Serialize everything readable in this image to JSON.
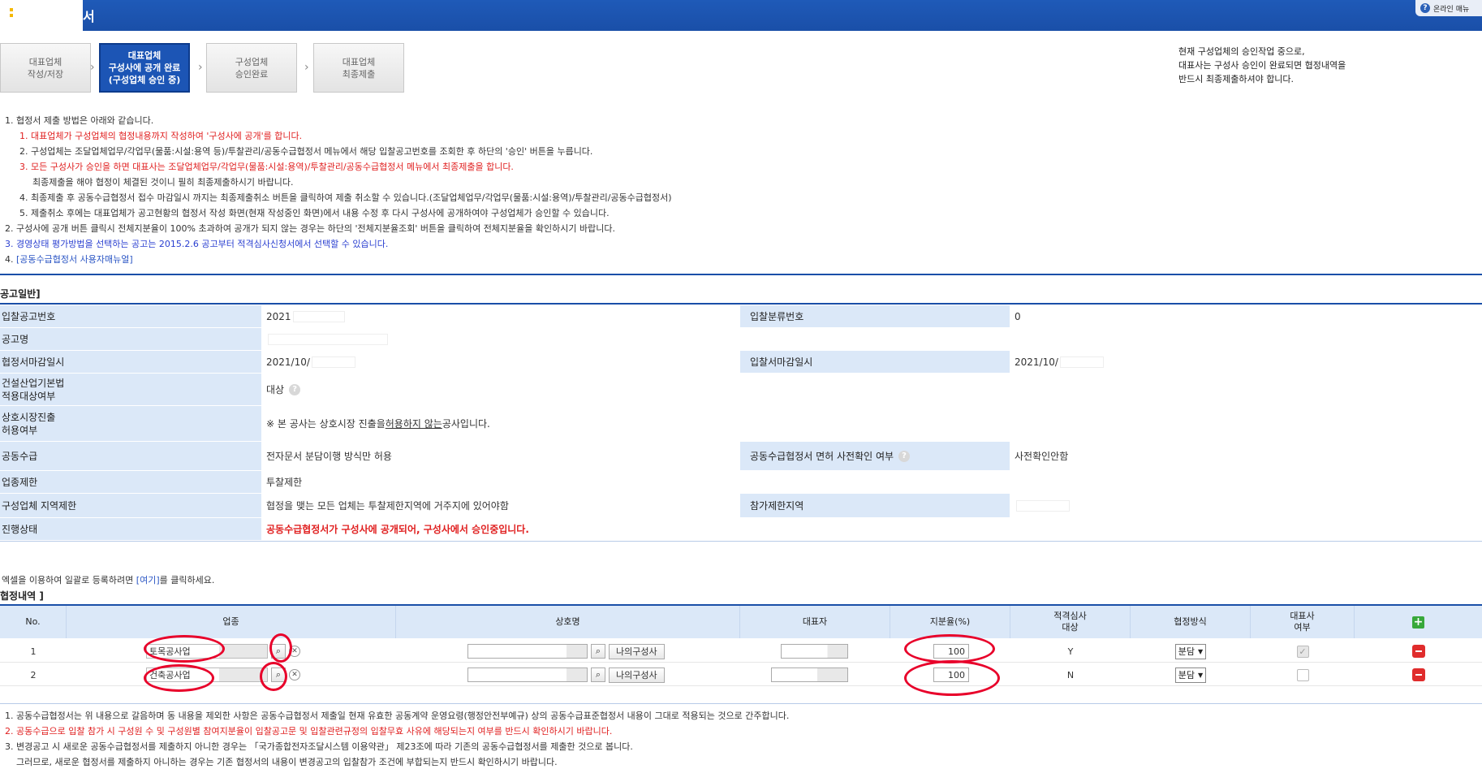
{
  "header": {
    "title": "서",
    "online_menu": "온라인 매뉴",
    "help_glyph": "?"
  },
  "steps": [
    {
      "label": "대표업체\n작성/저장"
    },
    {
      "label": "대표업체\n구성사에 공개 완료\n(구성업체 승인 중)"
    },
    {
      "label": "구성업체\n승인완료"
    },
    {
      "label": "대표업체\n최종제출"
    }
  ],
  "notice_right": "현재 구성업체의 승인작업 중으로,\n대표사는 구성사 승인이 완료되면 협정내역을\n반드시 최종제출하셔야 합니다.",
  "instructions": {
    "i1": "1. 협정서 제출 방법은 아래와 같습니다.",
    "i1_1": "1. 대표업체가 구성업체의 협정내용까지 작성하여 '구성사에 공개'를 합니다.",
    "i1_2": "2. 구성업체는 조달업체업무/각업무(물품:시설:용역 등)/투찰관리/공동수급협정서 메뉴에서 해당 입찰공고번호를 조회한 후 하단의 '승인' 버튼을 누릅니다.",
    "i1_3": "3. 모든 구성사가 승인을 하면 대표사는 조달업체업무/각업무(물품:시설:용역)/투찰관리/공동수급협정서 메뉴에서 최종제출을 합니다.",
    "i1_3b": "최종제출을 해야 협정이 체결된 것이니 필히 최종제출하시기 바랍니다.",
    "i1_4": "4. 최종제출 후 공동수급협정서 접수 마감일시 까지는 최종제출취소 버튼을 클릭하여 제출 취소할 수 있습니다.(조달업체업무/각업무(물품:시설:용역)/투찰관리/공동수급협정서)",
    "i1_5": "5. 제출취소 후에는 대표업체가 공고현황의 협정서 작성 화면(현재 작성중인 화면)에서 내용 수정 후 다시 구성사에 공개하여야 구성업체가 승인할 수 있습니다.",
    "i2": "2. 구성사에 공개 버튼 클릭시 전체지분율이 100% 초과하여 공개가 되지 않는 경우는 하단의 '전체지분율조회' 버튼을 클릭하여 전체지분율을 확인하시기 바랍니다.",
    "i3": "3. 경영상태 평가방법을 선택하는 공고는 2015.2.6 공고부터 적격심사신청서에서 선택할 수 있습니다.",
    "i4_num": "4. ",
    "i4_link": "[공동수급협정서 사용자매뉴얼]"
  },
  "section_general": "공고일반]",
  "info": {
    "bid_no_label": "입찰공고번호",
    "bid_no_value": "2021",
    "bid_class_label": "입찰분류번호",
    "bid_class_value": "0",
    "notice_name_label": "공고명",
    "deadline_label": "협정서마감일시",
    "deadline_value": "2021/10/",
    "bid_deadline_label": "입찰서마감일시",
    "bid_deadline_value": "2021/10/",
    "construction_label": "건설산업기본법\n적용대상여부",
    "construction_value": "대상",
    "mutual_label": "상호시장진출\n허용여부",
    "mutual_value_pre": "※ 본 공사는 상호시장 진출을 ",
    "mutual_value_u": "허용하지 않는",
    "mutual_value_post": " 공사입니다.",
    "joint_label": "공동수급",
    "joint_value": "전자문서 분담이행 방식만 허용",
    "precheck_label": "공동수급협정서 면허 사전확인 여부",
    "precheck_value": "사전확인안함",
    "industry_label": "업종제한",
    "industry_value": "투찰제한",
    "region_label": "구성업체 지역제한",
    "region_value": "협정을 맺는 모든 업체는 투찰제한지역에 거주지에 있어야함",
    "region_limit_label": "참가제한지역",
    "status_label": "진행상태",
    "status_value": "공동수급협정서가 구성사에 공개되어, 구성사에서 승인중입니다."
  },
  "excel_pre": "엑셀을 이용하여 일괄로 등록하려면 ",
  "excel_link": "[여기]",
  "excel_post": "를 클릭하세요.",
  "section_agreement": "협정내역 ]",
  "table": {
    "headers": {
      "no": "No.",
      "industry": "업종",
      "company": "상호명",
      "ceo": "대표자",
      "share": "지분율(%)",
      "qual": "적격심사\n대상",
      "method": "협정방식",
      "rep": "대표사\n여부"
    },
    "rows": [
      {
        "no": "1",
        "industry": "토목공사업",
        "my_btn": "나의구성사",
        "share": "100",
        "qual": "Y",
        "method": "분담"
      },
      {
        "no": "2",
        "industry": "건축공사업",
        "my_btn": "나의구성사",
        "share": "100",
        "qual": "N",
        "method": "분담"
      }
    ]
  },
  "bottom_notes": {
    "n1": "1. 공동수급협정서는 위 내용으로 갈음하며 동 내용을 제외한 사항은 공동수급협정서 제출일 현재 유효한 공동계약 운영요령(행정안전부예규) 상의 공동수급표준협정서 내용이 그대로 적용되는 것으로 간주합니다.",
    "n2": "2. 공동수급으로 입찰 참가 시 구성원 수 및 구성원별 참여지분율이 입찰공고문 및 입찰관련규정의 입찰무효 사유에 해당되는지 여부를 반드시 확인하시기 바랍니다.",
    "n3": "3. 변경공고 시 새로운 공동수급협정서를 제출하지 아니한 경우는 「국가종합전자조달시스템 이용약관」 제23조에 따라 기존의 공동수급협정서를 제출한 것으로 봅니다.",
    "n3b": "그러므로, 새로운 협정서를 제출하지 아니하는 경우는 기존 협정서의 내용이 변경공고의 입찰참가 조건에 부합되는지 반드시 확인하시기 바랍니다."
  },
  "colors": {
    "brand_blue": "#1a4fa8",
    "label_bg": "#dbe8f8",
    "alert_red": "#e02020",
    "annotation_red": "#e8002a"
  }
}
